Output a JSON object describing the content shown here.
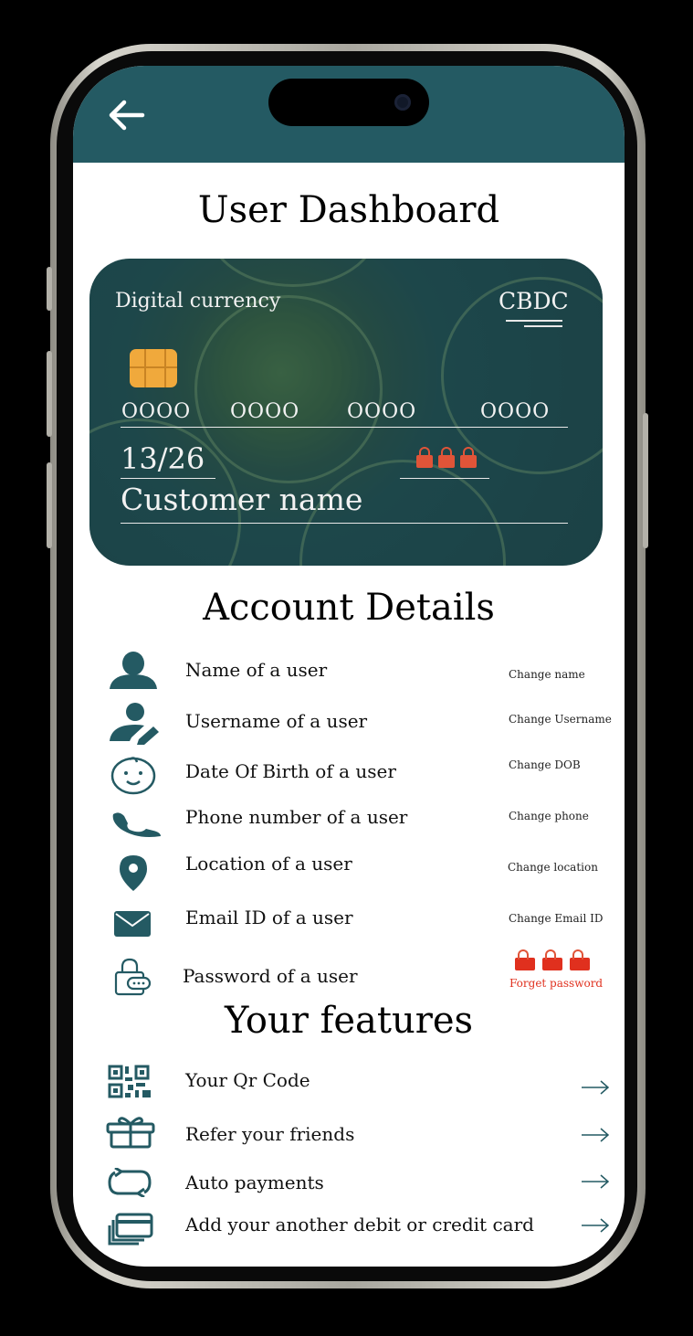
{
  "header": {
    "back_icon": "arrow-left-icon",
    "bar_color": "#245a63"
  },
  "page_title": "User Dashboard",
  "card": {
    "brand": "Digital currency",
    "type": "CBDC",
    "number_groups": [
      "OOOO",
      "OOOO",
      "OOOO",
      "OOOO"
    ],
    "expiry": "13/26",
    "holder": "Customer name",
    "chip_color": "#f0a93c",
    "lock_color": "#e05438"
  },
  "account": {
    "title": "Account Details",
    "rows": [
      {
        "icon": "user-icon",
        "label": "Name of a user",
        "action": "Change name"
      },
      {
        "icon": "user-edit-icon",
        "label": "Username of a user",
        "action": "Change Username"
      },
      {
        "icon": "baby-face-icon",
        "label": "Date Of Birth of a user",
        "action": "Change DOB"
      },
      {
        "icon": "phone-icon",
        "label": "Phone number of a user",
        "action": "Change phone"
      },
      {
        "icon": "location-pin-icon",
        "label": "Location of a user",
        "action": "Change location"
      },
      {
        "icon": "envelope-icon",
        "label": "Email ID of a user",
        "action": "Change Email ID"
      },
      {
        "icon": "password-lock-icon",
        "label": "Password of a user",
        "action": "Forget password"
      }
    ]
  },
  "features": {
    "title": "Your features",
    "items": [
      {
        "icon": "qr-code-icon",
        "label": "Your Qr Code"
      },
      {
        "icon": "gift-icon",
        "label": "Refer your friends"
      },
      {
        "icon": "repeat-icon",
        "label": "Auto payments"
      },
      {
        "icon": "cards-icon",
        "label": "Add your another debit or credit card"
      }
    ]
  },
  "colors": {
    "accent": "#245a63",
    "danger": "#e0301e"
  }
}
